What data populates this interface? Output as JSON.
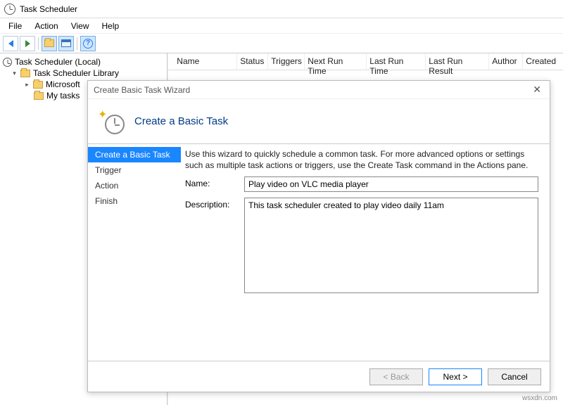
{
  "app": {
    "title": "Task Scheduler"
  },
  "menu": {
    "file": "File",
    "action": "Action",
    "view": "View",
    "help": "Help"
  },
  "tree": {
    "root": "Task Scheduler (Local)",
    "library": "Task Scheduler Library",
    "microsoft": "Microsoft",
    "mytasks": "My tasks"
  },
  "columns": {
    "name": "Name",
    "status": "Status",
    "triggers": "Triggers",
    "next": "Next Run Time",
    "last": "Last Run Time",
    "result": "Last Run Result",
    "author": "Author",
    "created": "Created"
  },
  "wizard": {
    "windowTitle": "Create Basic Task Wizard",
    "heading": "Create a Basic Task",
    "steps": {
      "create": "Create a Basic Task",
      "trigger": "Trigger",
      "action": "Action",
      "finish": "Finish"
    },
    "instruction": "Use this wizard to quickly schedule a common task.  For more advanced options or settings such as multiple task actions or triggers, use the Create Task command in the Actions pane.",
    "nameLabel": "Name:",
    "nameValue": "Play video on VLC media player",
    "descLabel": "Description:",
    "descValue": "This task scheduler created to play video daily 11am",
    "back": "< Back",
    "next": "Next >",
    "cancel": "Cancel"
  },
  "watermark": "wsxdn.com"
}
